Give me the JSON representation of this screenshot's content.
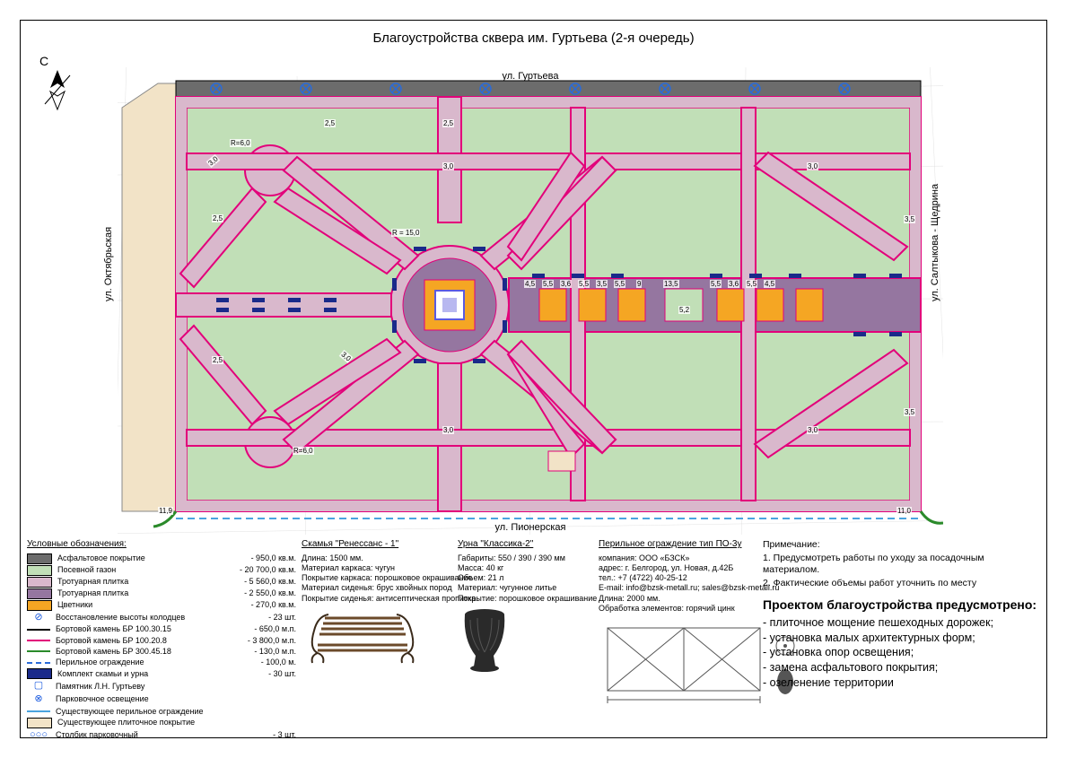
{
  "title": "Благоустройства сквера им. Гуртьева (2-я очередь)",
  "compass_label": "С",
  "streets": {
    "top": "ул. Гуртьева",
    "bottom": "ул. Пионерская",
    "left": "ул. Октябрьская",
    "right": "ул. Салтыкова - Щедрина"
  },
  "plan_dims": {
    "r_big": "R = 15,0",
    "r_small1": "R=6,0",
    "r_small2": "R=6,0",
    "w25a": "2,5",
    "w25b": "2,5",
    "w25c": "2,5",
    "w25d": "2,5",
    "w30a": "3,0",
    "w30b": "3,0",
    "w30c": "3,0",
    "w30d": "3,0",
    "w30e": "3,0",
    "w30f": "3,0",
    "w35a": "3,5",
    "w35b": "3,5",
    "e119": "11,9",
    "e110": "11,0",
    "p45": "4,5",
    "p55a": "5,5",
    "p36a": "3,6",
    "p55b": "5,5",
    "p35": "3,5",
    "p55c": "5,5",
    "p9": "9",
    "p135": "13,5",
    "p55d": "5,5",
    "p36b": "3,6",
    "p55e": "5,5",
    "p45b": "4,5",
    "p52": "5,2"
  },
  "legend_heading": "Условные обозначения:",
  "legend": [
    {
      "kind": "box",
      "fill": "#6c6c6c",
      "label": "Асфальтовое покрытие",
      "val": "- 950,0 кв.м."
    },
    {
      "kind": "box",
      "fill": "#c1dfb7",
      "label": "Посевной газон",
      "val": "- 20 700,0 кв.м."
    },
    {
      "kind": "box",
      "fill": "#d9b8cc",
      "label": "Тротуарная плитка",
      "val": "- 5 560,0 кв.м."
    },
    {
      "kind": "box",
      "fill": "#9576a0",
      "label": "Тротуарная плитка",
      "val": "- 2 550,0 кв.м."
    },
    {
      "kind": "box",
      "fill": "#f5a623",
      "label": "Цветники",
      "val": "- 270,0 кв.м."
    },
    {
      "kind": "sym",
      "sym": "⊘",
      "label": "Восстановление высоты колодцев",
      "val": "- 23 шт."
    },
    {
      "kind": "line",
      "color": "#000",
      "label": "Бортовой камень БР 100.30.15",
      "val": "- 650,0 м.п."
    },
    {
      "kind": "line",
      "color": "#e2007a",
      "label": "Бортовой камень БР 100.20.8",
      "val": "- 3 800,0 м.п."
    },
    {
      "kind": "line",
      "color": "#2a8a2a",
      "label": "Бортовой камень БР 300.45.18",
      "val": "- 130,0 м.п."
    },
    {
      "kind": "dash",
      "color": "#2a6bd8",
      "label": "Перильное ограждение",
      "val": "- 100,0 м."
    },
    {
      "kind": "box",
      "fill": "#1a2a8a",
      "label": "Комплект скамьи и урна",
      "val": "- 30 шт."
    },
    {
      "kind": "sym",
      "sym": "▢",
      "label": "Памятник Л.Н. Гуртьеву",
      "val": ""
    },
    {
      "kind": "sym",
      "sym": "⊗",
      "label": "Парковочное освещение",
      "val": ""
    },
    {
      "kind": "line",
      "color": "#4aa3df",
      "label": "Существующее перильное ограждение",
      "val": ""
    },
    {
      "kind": "box",
      "fill": "#f2e3c7",
      "label": "Существующее плиточное покрытие",
      "val": ""
    },
    {
      "kind": "sym",
      "sym": "○○○",
      "label": "Столбик парковочный",
      "val": "- 3 шт."
    }
  ],
  "bench": {
    "title": "Скамья \"Ренессанс - 1\"",
    "lines": [
      "Длина: 1500 мм.",
      "Материал каркаса: чугун",
      "Покрытие каркаса: порошковое окрашивание",
      "Материал сиденья: брус хвойных пород",
      "Покрытие сиденья: антисептическая пропитка"
    ]
  },
  "urn": {
    "title": "Урна \"Классика-2\"",
    "lines": [
      "Габариты: 550 / 390 / 390 мм",
      "Масса: 40 кг",
      "Объем: 21 л",
      "Материал: чугунное литье",
      "Покрытие: порошковое окрашивание"
    ]
  },
  "railing": {
    "title": "Перильное ограждение тип ПО-3у",
    "lines": [
      "компания: ООО «БЗСК»",
      "адрес: г. Белгород, ул. Новая, д.42Б",
      "тел.:  +7 (4722) 40-25-12",
      "E-mail:  info@bzsk-metall.ru; sales@bzsk-metall.ru",
      "Длина: 2000 мм.",
      "Обработка элементов: горячий цинк"
    ]
  },
  "notes_heading": "Примечание:",
  "notes": [
    "1. Предусмотреть работы по уходу за посадочным материалом.",
    "2. Фактические объемы работ уточнить по месту"
  ],
  "scope_heading": "Проектом благоустройства предусмотрено:",
  "scope": [
    "- плиточное мощение пешеходных дорожек;",
    "- установка малых архитектурных форм;",
    "- установка опор освещения;",
    "- замена асфальтового покрытия;",
    "- озеленение территории"
  ]
}
